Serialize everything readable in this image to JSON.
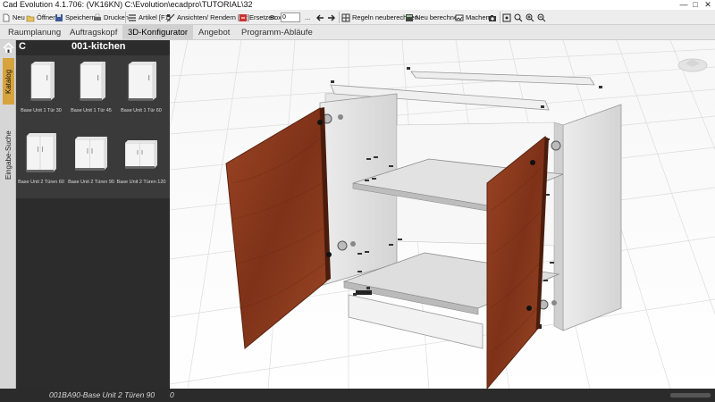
{
  "app": {
    "title": "Cad Evolution 4.1.706: (VK16KN)  C:\\Evolution\\ecadpro\\TUTORIAL\\32",
    "window_controls": [
      "—",
      "□",
      "✕"
    ]
  },
  "toolbar": {
    "neu": "Neu",
    "oeffnen": "Öffnen",
    "speichern": "Speichern",
    "drucken": "Drucken",
    "artikel": "Artikel [F1]",
    "ansichten": "Ansichten/ Rendern [F2]",
    "ersetzen": "Ersetzen",
    "box_label": "Box",
    "box_value": "0",
    "ellipsis": "...",
    "regeln": "Regeln neuberechnen",
    "neu_berechnen": "Neu berechnen",
    "machen": "Machen"
  },
  "nav": {
    "tabs": [
      "Raumplanung",
      "Auftragskopf",
      "3D-Konfigurator",
      "Angebot",
      "Programm-Abläufe"
    ],
    "active_index": 2
  },
  "side_tabs": [
    "Katalog",
    "Eingabe-Suche"
  ],
  "panel": {
    "letter": "C",
    "title": "001-kitchen",
    "items": [
      {
        "label": "Base Unit 1 Tür 30"
      },
      {
        "label": "Base Unit 1 Tür 45"
      },
      {
        "label": "Base Unit 1 Tür 60"
      },
      {
        "label": "Base Unit 2 Türen 60"
      },
      {
        "label": "Base Unit 2 Türen 90"
      },
      {
        "label": "Base Unit 2 Türen 120"
      }
    ]
  },
  "status": {
    "text": "001BA90-Base Unit 2 Türen 90",
    "number": "0"
  },
  "colors": {
    "door": "#8a3a1c",
    "panel_bg": "#2c2c2c",
    "active_side_tab": "#d6a33c"
  }
}
